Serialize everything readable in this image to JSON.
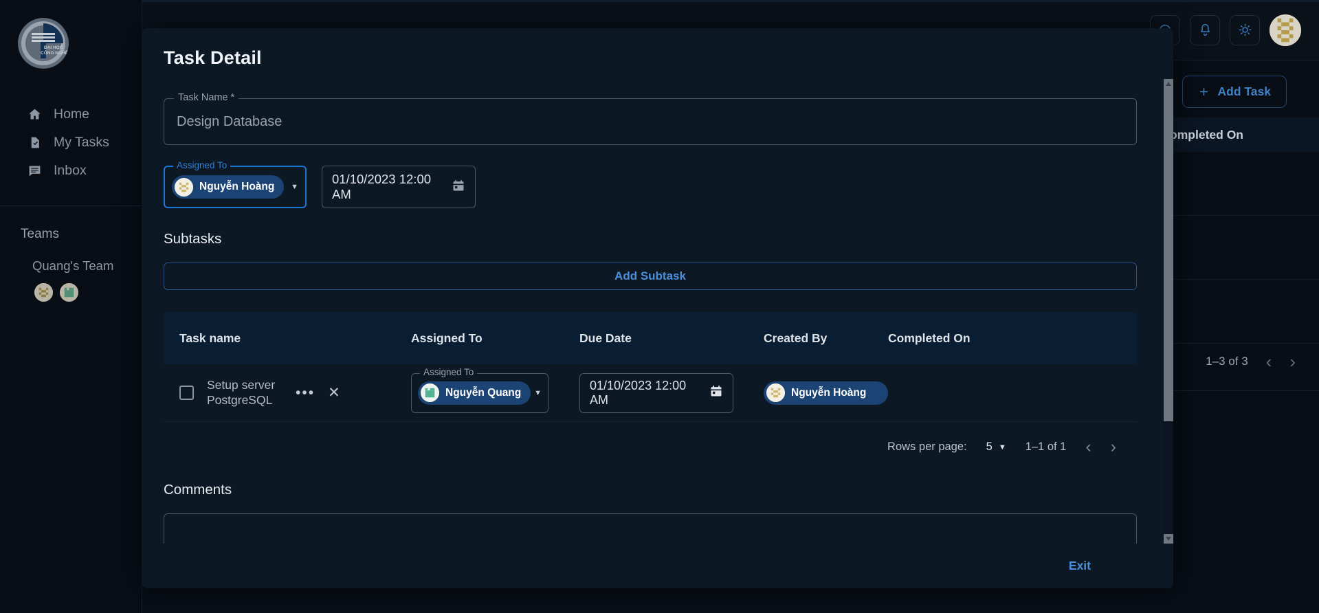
{
  "brand": {
    "logo_alt": "university-logo",
    "logo_text_1": "ĐẠI HỌC",
    "logo_text_2": "CÔNG NGHỆ"
  },
  "topbar": {
    "icons": [
      {
        "name": "headset-icon",
        "glyph": "headset"
      },
      {
        "name": "notification-bell-icon",
        "glyph": "bell"
      },
      {
        "name": "brightness-icon",
        "glyph": "sun"
      }
    ],
    "avatar_name": "user-avatar"
  },
  "sidebar": {
    "items": [
      {
        "label": "Home",
        "icon": "home-icon"
      },
      {
        "label": "My Tasks",
        "icon": "document-check-icon"
      },
      {
        "label": "Inbox",
        "icon": "message-icon"
      }
    ],
    "teams_label": "Teams",
    "team": {
      "name": "Quang's Team",
      "members": [
        "Nguyễn Hoàng",
        "Nguyễn Quang"
      ]
    }
  },
  "background_page": {
    "add_task_label": "Add Task",
    "completed_on_header": "Completed On",
    "pagination_range": "1–3 of 3"
  },
  "modal": {
    "title": "Task Detail",
    "task_name": {
      "legend": "Task Name *",
      "value": "Design Database"
    },
    "assigned_to": {
      "legend": "Assigned To",
      "value": "Nguyễn Hoàng"
    },
    "due_date": {
      "value": "01/10/2023 12:00 AM"
    },
    "subtasks_title": "Subtasks",
    "add_subtask_label": "Add Subtask",
    "table": {
      "columns": [
        "Task name",
        "Assigned To",
        "Due Date",
        "Created By",
        "Completed On"
      ],
      "rows": [
        {
          "checked": false,
          "task_name": "Setup server PostgreSQL",
          "assigned_legend": "Assigned To",
          "assigned_to": "Nguyễn Quang",
          "due_date": "01/10/2023 12:00 AM",
          "created_by": "Nguyễn Hoàng",
          "completed_on": ""
        }
      ]
    },
    "pagination": {
      "rows_per_page_label": "Rows per page:",
      "rows_per_page_value": "5",
      "range": "1–1 of 1"
    },
    "comments_title": "Comments",
    "exit_label": "Exit"
  },
  "colors": {
    "accent": "#4a90d9",
    "focus_blue": "#1976d2",
    "chip_bg": "#1b4373",
    "page_bg": "#080d16",
    "modal_bg": "#0d1825",
    "table_head_bg": "#0a1e33"
  }
}
